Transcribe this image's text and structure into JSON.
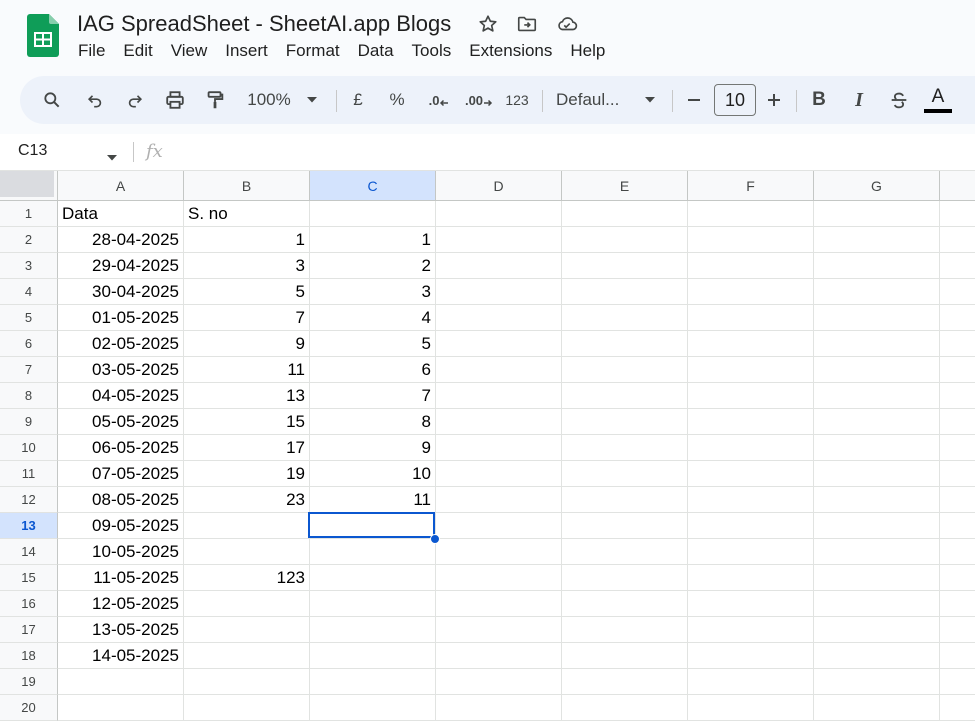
{
  "document": {
    "title": "IAG SpreadSheet - SheetAI.app Blogs"
  },
  "menu": [
    "File",
    "Edit",
    "View",
    "Insert",
    "Format",
    "Data",
    "Tools",
    "Extensions",
    "Help"
  ],
  "toolbar": {
    "zoom": "100%",
    "currency": "£",
    "percent": "%",
    "decrease_decimal": ".0",
    "increase_decimal": ".00",
    "number_format": "123",
    "font_family": "Defaul...",
    "font_size": "10",
    "bold": "B",
    "italic": "I",
    "text_color": "A"
  },
  "formula_bar": {
    "cell_ref": "C13",
    "fx": "fx",
    "value": ""
  },
  "sheet": {
    "columns": [
      "A",
      "B",
      "C",
      "D",
      "E",
      "F",
      "G"
    ],
    "selected_column": "C",
    "selected_row": 13,
    "rows": [
      {
        "num": "1",
        "a": "Data",
        "b": "S. no",
        "c": ""
      },
      {
        "num": "2",
        "a": "28-04-2025",
        "b": "1",
        "c": "1"
      },
      {
        "num": "3",
        "a": "29-04-2025",
        "b": "3",
        "c": "2"
      },
      {
        "num": "4",
        "a": "30-04-2025",
        "b": "5",
        "c": "3"
      },
      {
        "num": "5",
        "a": "01-05-2025",
        "b": "7",
        "c": "4"
      },
      {
        "num": "6",
        "a": "02-05-2025",
        "b": "9",
        "c": "5"
      },
      {
        "num": "7",
        "a": "03-05-2025",
        "b": "11",
        "c": "6"
      },
      {
        "num": "8",
        "a": "04-05-2025",
        "b": "13",
        "c": "7"
      },
      {
        "num": "9",
        "a": "05-05-2025",
        "b": "15",
        "c": "8"
      },
      {
        "num": "10",
        "a": "06-05-2025",
        "b": "17",
        "c": "9"
      },
      {
        "num": "11",
        "a": "07-05-2025",
        "b": "19",
        "c": "10"
      },
      {
        "num": "12",
        "a": "08-05-2025",
        "b": "23",
        "c": "11"
      },
      {
        "num": "13",
        "a": "09-05-2025",
        "b": "",
        "c": ""
      },
      {
        "num": "14",
        "a": "10-05-2025",
        "b": "",
        "c": ""
      },
      {
        "num": "15",
        "a": "11-05-2025",
        "b": "123",
        "c": ""
      },
      {
        "num": "16",
        "a": "12-05-2025",
        "b": "",
        "c": ""
      },
      {
        "num": "17",
        "a": "13-05-2025",
        "b": "",
        "c": ""
      },
      {
        "num": "18",
        "a": "14-05-2025",
        "b": "",
        "c": ""
      },
      {
        "num": "19",
        "a": "",
        "b": "",
        "c": ""
      },
      {
        "num": "20",
        "a": "",
        "b": "",
        "c": ""
      }
    ]
  },
  "colors": {
    "accent": "#0b57d0",
    "sheets_green": "#0f9d58",
    "header_bg": "#f9fbfd",
    "toolbar_bg": "#edf2fa"
  }
}
